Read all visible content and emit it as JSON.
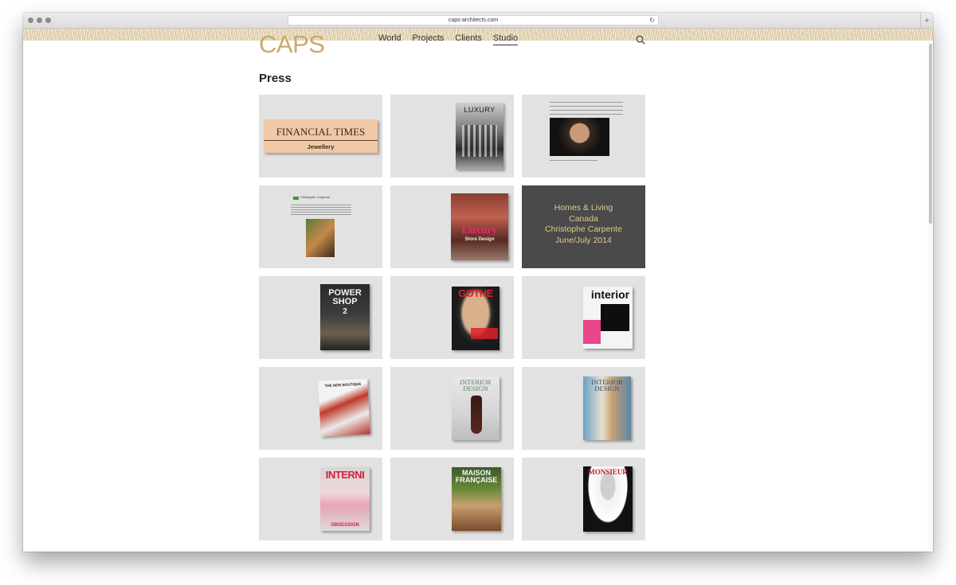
{
  "browser": {
    "url": "caps-architects.com",
    "reload_icon": "reload-icon",
    "new_tab_icon": "plus-icon"
  },
  "site": {
    "logo": "CAPS",
    "accent_color": "#cbaa6c",
    "nav": [
      {
        "label": "World",
        "active": false
      },
      {
        "label": "Projects",
        "active": false
      },
      {
        "label": "Clients",
        "active": false
      },
      {
        "label": "Studio",
        "active": true
      }
    ],
    "search_icon": "search-icon"
  },
  "page": {
    "title": "Press",
    "tiles": [
      {
        "name": "financial-times",
        "cover_title": "FINANCIAL TIMES",
        "cover_sub": "Jewellery"
      },
      {
        "name": "luxury",
        "cover_title": "LUXURY"
      },
      {
        "name": "article-portrait"
      },
      {
        "name": "chinese-article",
        "headline": "Christophe Carpente"
      },
      {
        "name": "luxury-store-design",
        "cover_title": "Luxury",
        "cover_sub": "Store Design"
      },
      {
        "name": "homes-living",
        "caption": [
          "Homes & Living",
          "Canada",
          "Christophe Carpente",
          "June/July 2014"
        ]
      },
      {
        "name": "power-shop",
        "cover_title": "POWER SHOP",
        "cover_sub": "2"
      },
      {
        "name": "gothe",
        "cover_title": "GOTHE"
      },
      {
        "name": "interior",
        "cover_title": "interior"
      },
      {
        "name": "new-boutique",
        "cover_title": "THE NEW BOUTIQUE"
      },
      {
        "name": "interior-design-1",
        "cover_title": "INTERIOR DESIGN"
      },
      {
        "name": "interior-design-2",
        "cover_title": "INTERIOR DESIGN"
      },
      {
        "name": "interni",
        "cover_title": "INTERNI",
        "cover_sub": "OBSESSION"
      },
      {
        "name": "maison-francaise",
        "cover_title": "MAISON FRANÇAISE"
      },
      {
        "name": "monsieur",
        "cover_title": "MONSIEUR"
      }
    ]
  }
}
